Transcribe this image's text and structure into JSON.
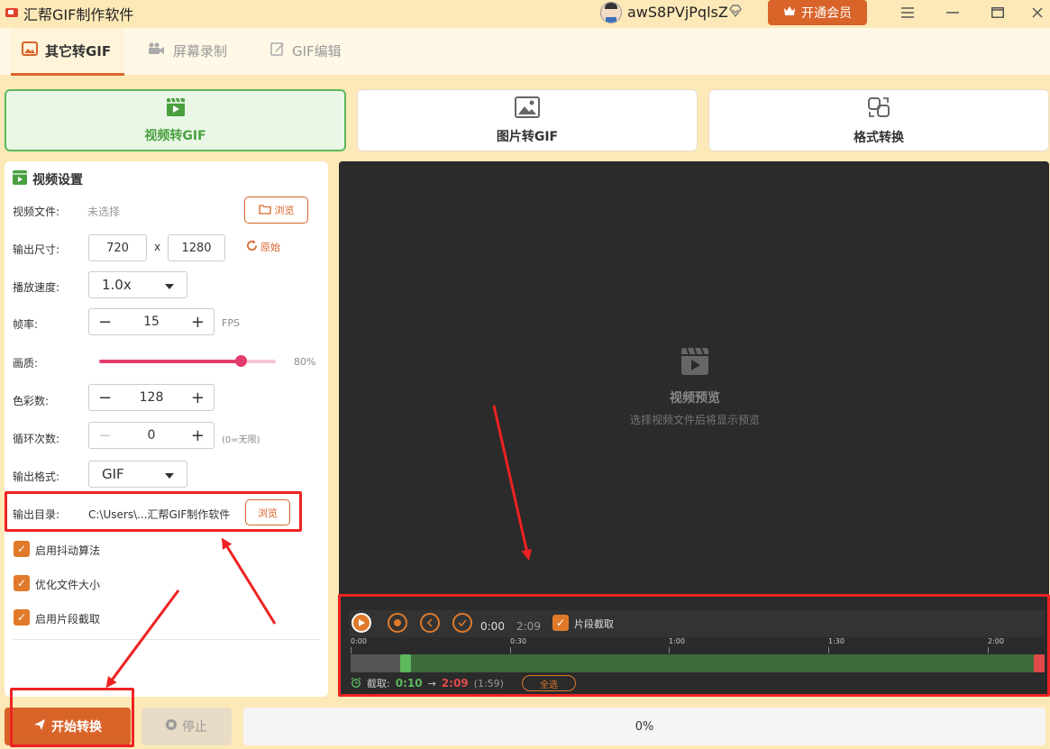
{
  "app": {
    "title": "汇帮GIF制作软件",
    "username": "awS8PVjPqlsZ",
    "vip_label": "开通会员"
  },
  "tabs": [
    {
      "label": "其它转GIF"
    },
    {
      "label": "屏幕录制"
    },
    {
      "label": "GIF编辑"
    }
  ],
  "modes": [
    {
      "label": "视频转GIF"
    },
    {
      "label": "图片转GIF"
    },
    {
      "label": "格式转换"
    }
  ],
  "settings": {
    "title": "视频设置",
    "video_file_label": "视频文件:",
    "video_file_value": "未选择",
    "browse_label": "浏览",
    "size_label": "输出尺寸:",
    "width": "720",
    "times": "x",
    "height": "1280",
    "original_label": "原始",
    "speed_label": "播放速度:",
    "speed_value": "1.0x",
    "fps_label": "帧率:",
    "fps_value": "15",
    "fps_unit": "FPS",
    "quality_label": "画质:",
    "quality_text": "80%",
    "quality_value": 0.8,
    "colors_label": "色彩数:",
    "colors_value": "128",
    "loop_label": "循环次数:",
    "loop_value": "0",
    "loop_hint": "(0=无限)",
    "format_label": "输出格式:",
    "format_value": "GIF",
    "outdir_label": "输出目录:",
    "outdir_value": "C:\\Users\\...汇帮GIF制作软件",
    "outdir_browse": "浏览",
    "dither_label": "启用抖动算法",
    "optimize_label": "优化文件大小",
    "segment_label": "启用片段截取"
  },
  "preview": {
    "title": "视频预览",
    "subtitle": "选择视频文件后将显示预览",
    "time_current": "0:00",
    "time_total": "2:09",
    "segment_label": "片段截取",
    "ticks": [
      "0:00",
      "0:30",
      "1:00",
      "1:30",
      "2:00"
    ],
    "clip_label": "截取:",
    "clip_start": "0:10",
    "clip_arrow": "→",
    "clip_end": "2:09",
    "clip_duration": "(1:59)",
    "select_all": "全选"
  },
  "actions": {
    "start_label": "开始转换",
    "stop_label": "停止",
    "progress_text": "0%"
  },
  "colors": {
    "accent": "#d9642a",
    "green": "#5cb85c",
    "annotation_red": "#ee2222",
    "quality_slider": "#e23c6c"
  }
}
